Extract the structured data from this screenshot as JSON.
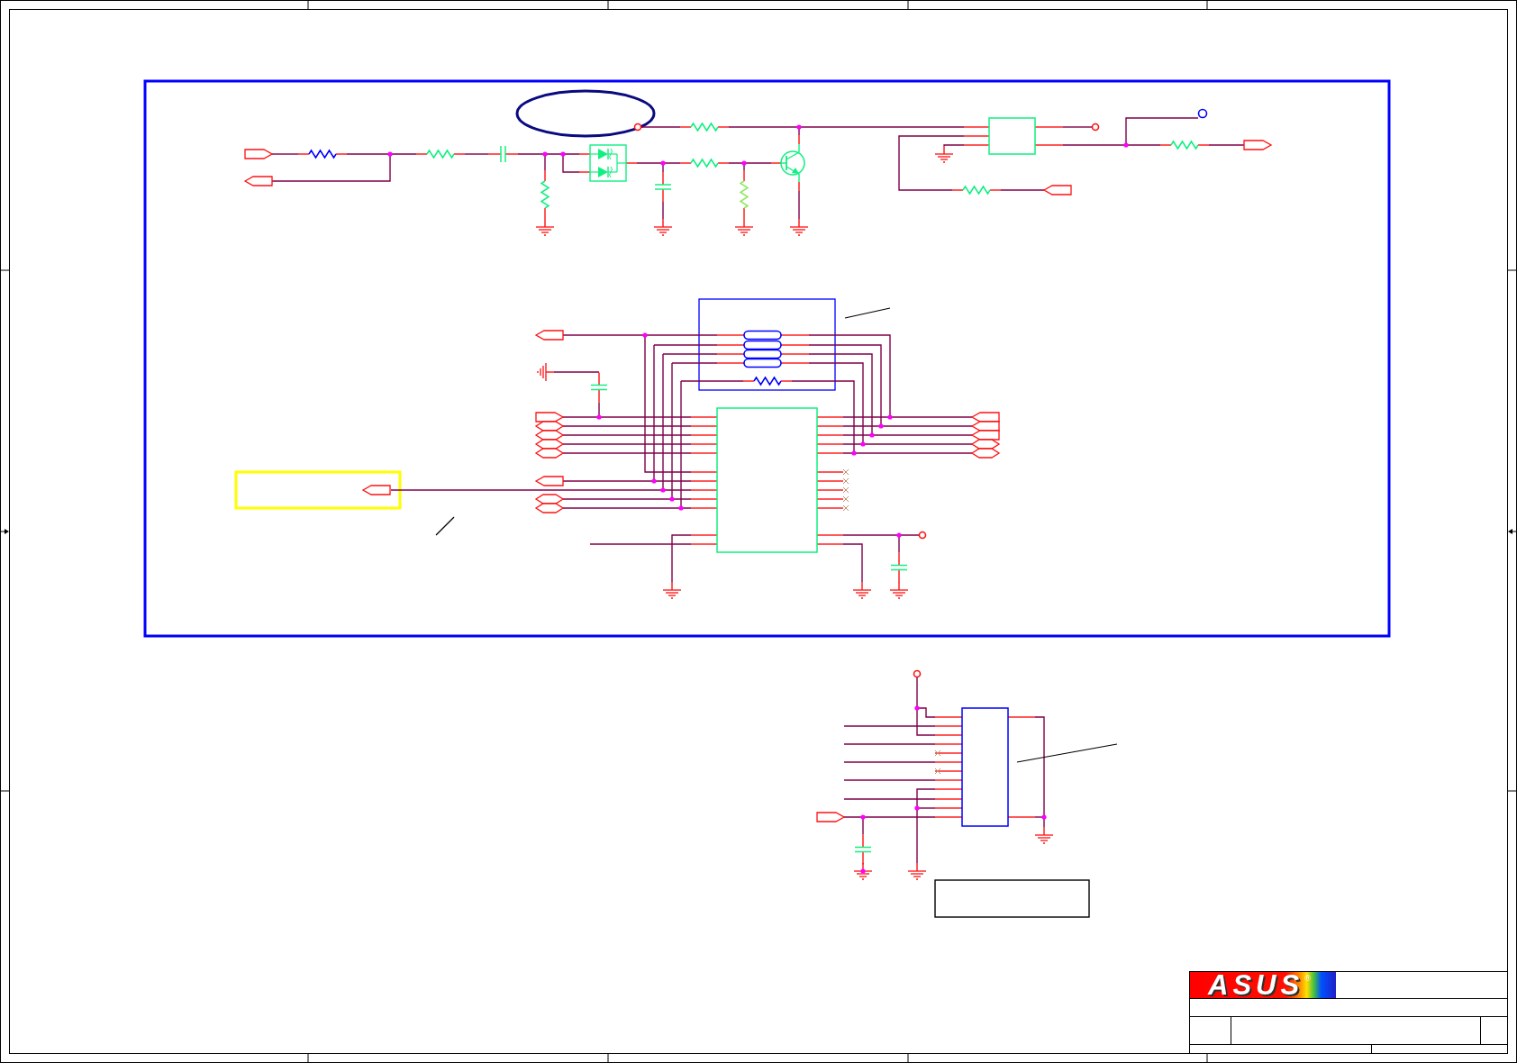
{
  "title_block": {
    "logo": {
      "text": "ASUS",
      "mark": "®"
    }
  }
}
